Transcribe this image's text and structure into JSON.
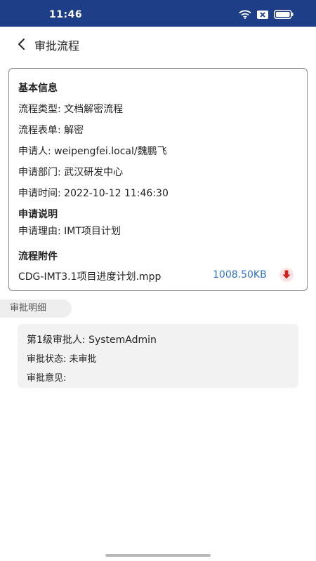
{
  "status_bar": {
    "time": "11:46",
    "background_color": "#1e3f87",
    "icons": [
      "wifi-icon",
      "sim-off-icon",
      "battery-icon"
    ]
  },
  "nav": {
    "title": "审批流程",
    "back_icon": "chevron-left-icon"
  },
  "basic_info": {
    "section_title": "基本信息",
    "process_type": "流程类型: 文档解密流程",
    "process_form": "流程表单: 解密",
    "applicant": "申请人: weipengfei.local/魏鹏飞",
    "department": "申请部门: 武汉研发中心",
    "apply_time": "申请时间: 2022-10-12 11:46:30"
  },
  "application_note": {
    "section_title": "申请说明",
    "reason": "申请理由: IMT项目计划"
  },
  "attachments": {
    "section_title": "流程附件",
    "files": [
      {
        "name": "CDG-IMT3.1项目进度计划.mpp",
        "size": "1008.50KB",
        "action_icon": "download-icon"
      }
    ]
  },
  "approval_details": {
    "tab_label": "审批明细",
    "approvers": [
      {
        "level": "第1级审批人: SystemAdmin",
        "status": "审批状态: 未审批",
        "opinion": "审批意见:"
      }
    ]
  },
  "colors": {
    "accent_link": "#2f73c8",
    "download_icon": "#cc1f1f"
  }
}
